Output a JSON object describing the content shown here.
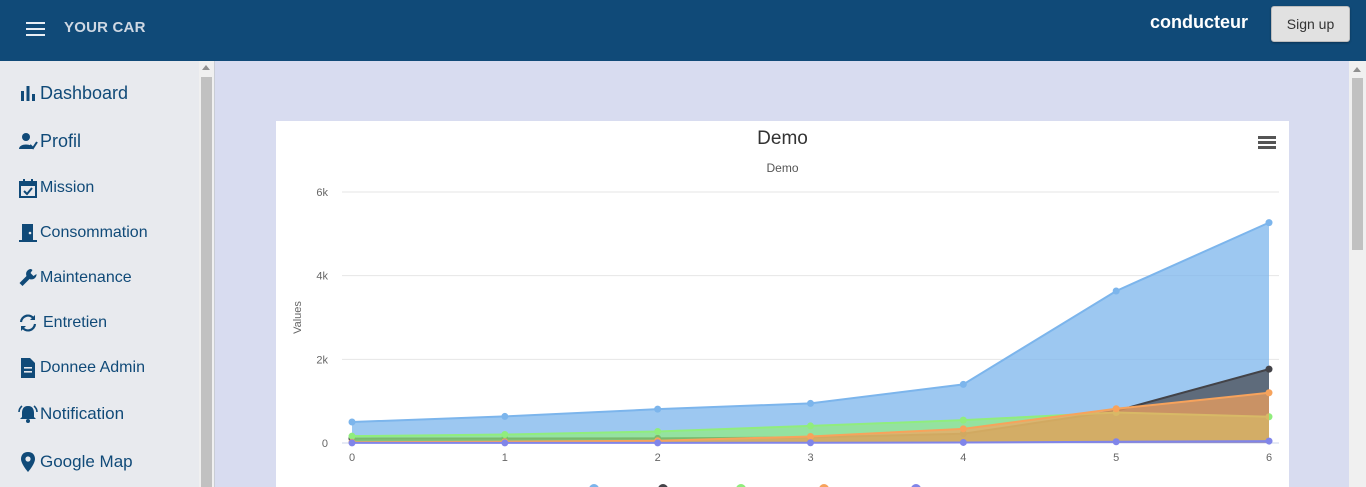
{
  "header": {
    "brand": "YOUR CAR",
    "user": "conducteur",
    "signup_label": "Sign up"
  },
  "sidebar": {
    "items": [
      {
        "label": "Dashboard",
        "icon": "bar-chart-icon"
      },
      {
        "label": "Profil",
        "icon": "user-check-icon"
      },
      {
        "label": "Mission",
        "icon": "calendar-check-icon"
      },
      {
        "label": "Consommation",
        "icon": "door-icon"
      },
      {
        "label": "Maintenance",
        "icon": "wrench-icon"
      },
      {
        "label": "Entretien",
        "icon": "sync-icon"
      },
      {
        "label": "Donnee Admin",
        "icon": "document-icon"
      },
      {
        "label": "Notification",
        "icon": "bell-icon"
      },
      {
        "label": "Google Map",
        "icon": "map-pin-icon"
      }
    ]
  },
  "chart_data": {
    "type": "area",
    "title": "Demo",
    "subtitle": "Demo",
    "ylabel": "Values",
    "xlabel": "",
    "x": [
      0,
      1,
      2,
      3,
      4,
      5,
      6
    ],
    "ylim": [
      0,
      6000
    ],
    "yticks": [
      0,
      2000,
      4000,
      6000
    ],
    "ytick_labels": [
      "0",
      "2k",
      "4k",
      "6k"
    ],
    "grid": true,
    "stacked": false,
    "series": [
      {
        "color": "#7cb5ec",
        "values": [
          502,
          635,
          809,
          947,
          1402,
          3634,
          5268
        ]
      },
      {
        "color": "#434348",
        "values": [
          106,
          107,
          111,
          133,
          221,
          767,
          1766
        ]
      },
      {
        "color": "#90ed7d",
        "values": [
          163,
          203,
          276,
          408,
          547,
          729,
          628
        ]
      },
      {
        "color": "#f7a35c",
        "values": [
          18,
          31,
          54,
          156,
          339,
          818,
          1201
        ]
      },
      {
        "color": "#8085e9",
        "values": [
          2,
          2,
          2,
          6,
          13,
          30,
          46
        ]
      }
    ],
    "legend_position": "bottom"
  }
}
